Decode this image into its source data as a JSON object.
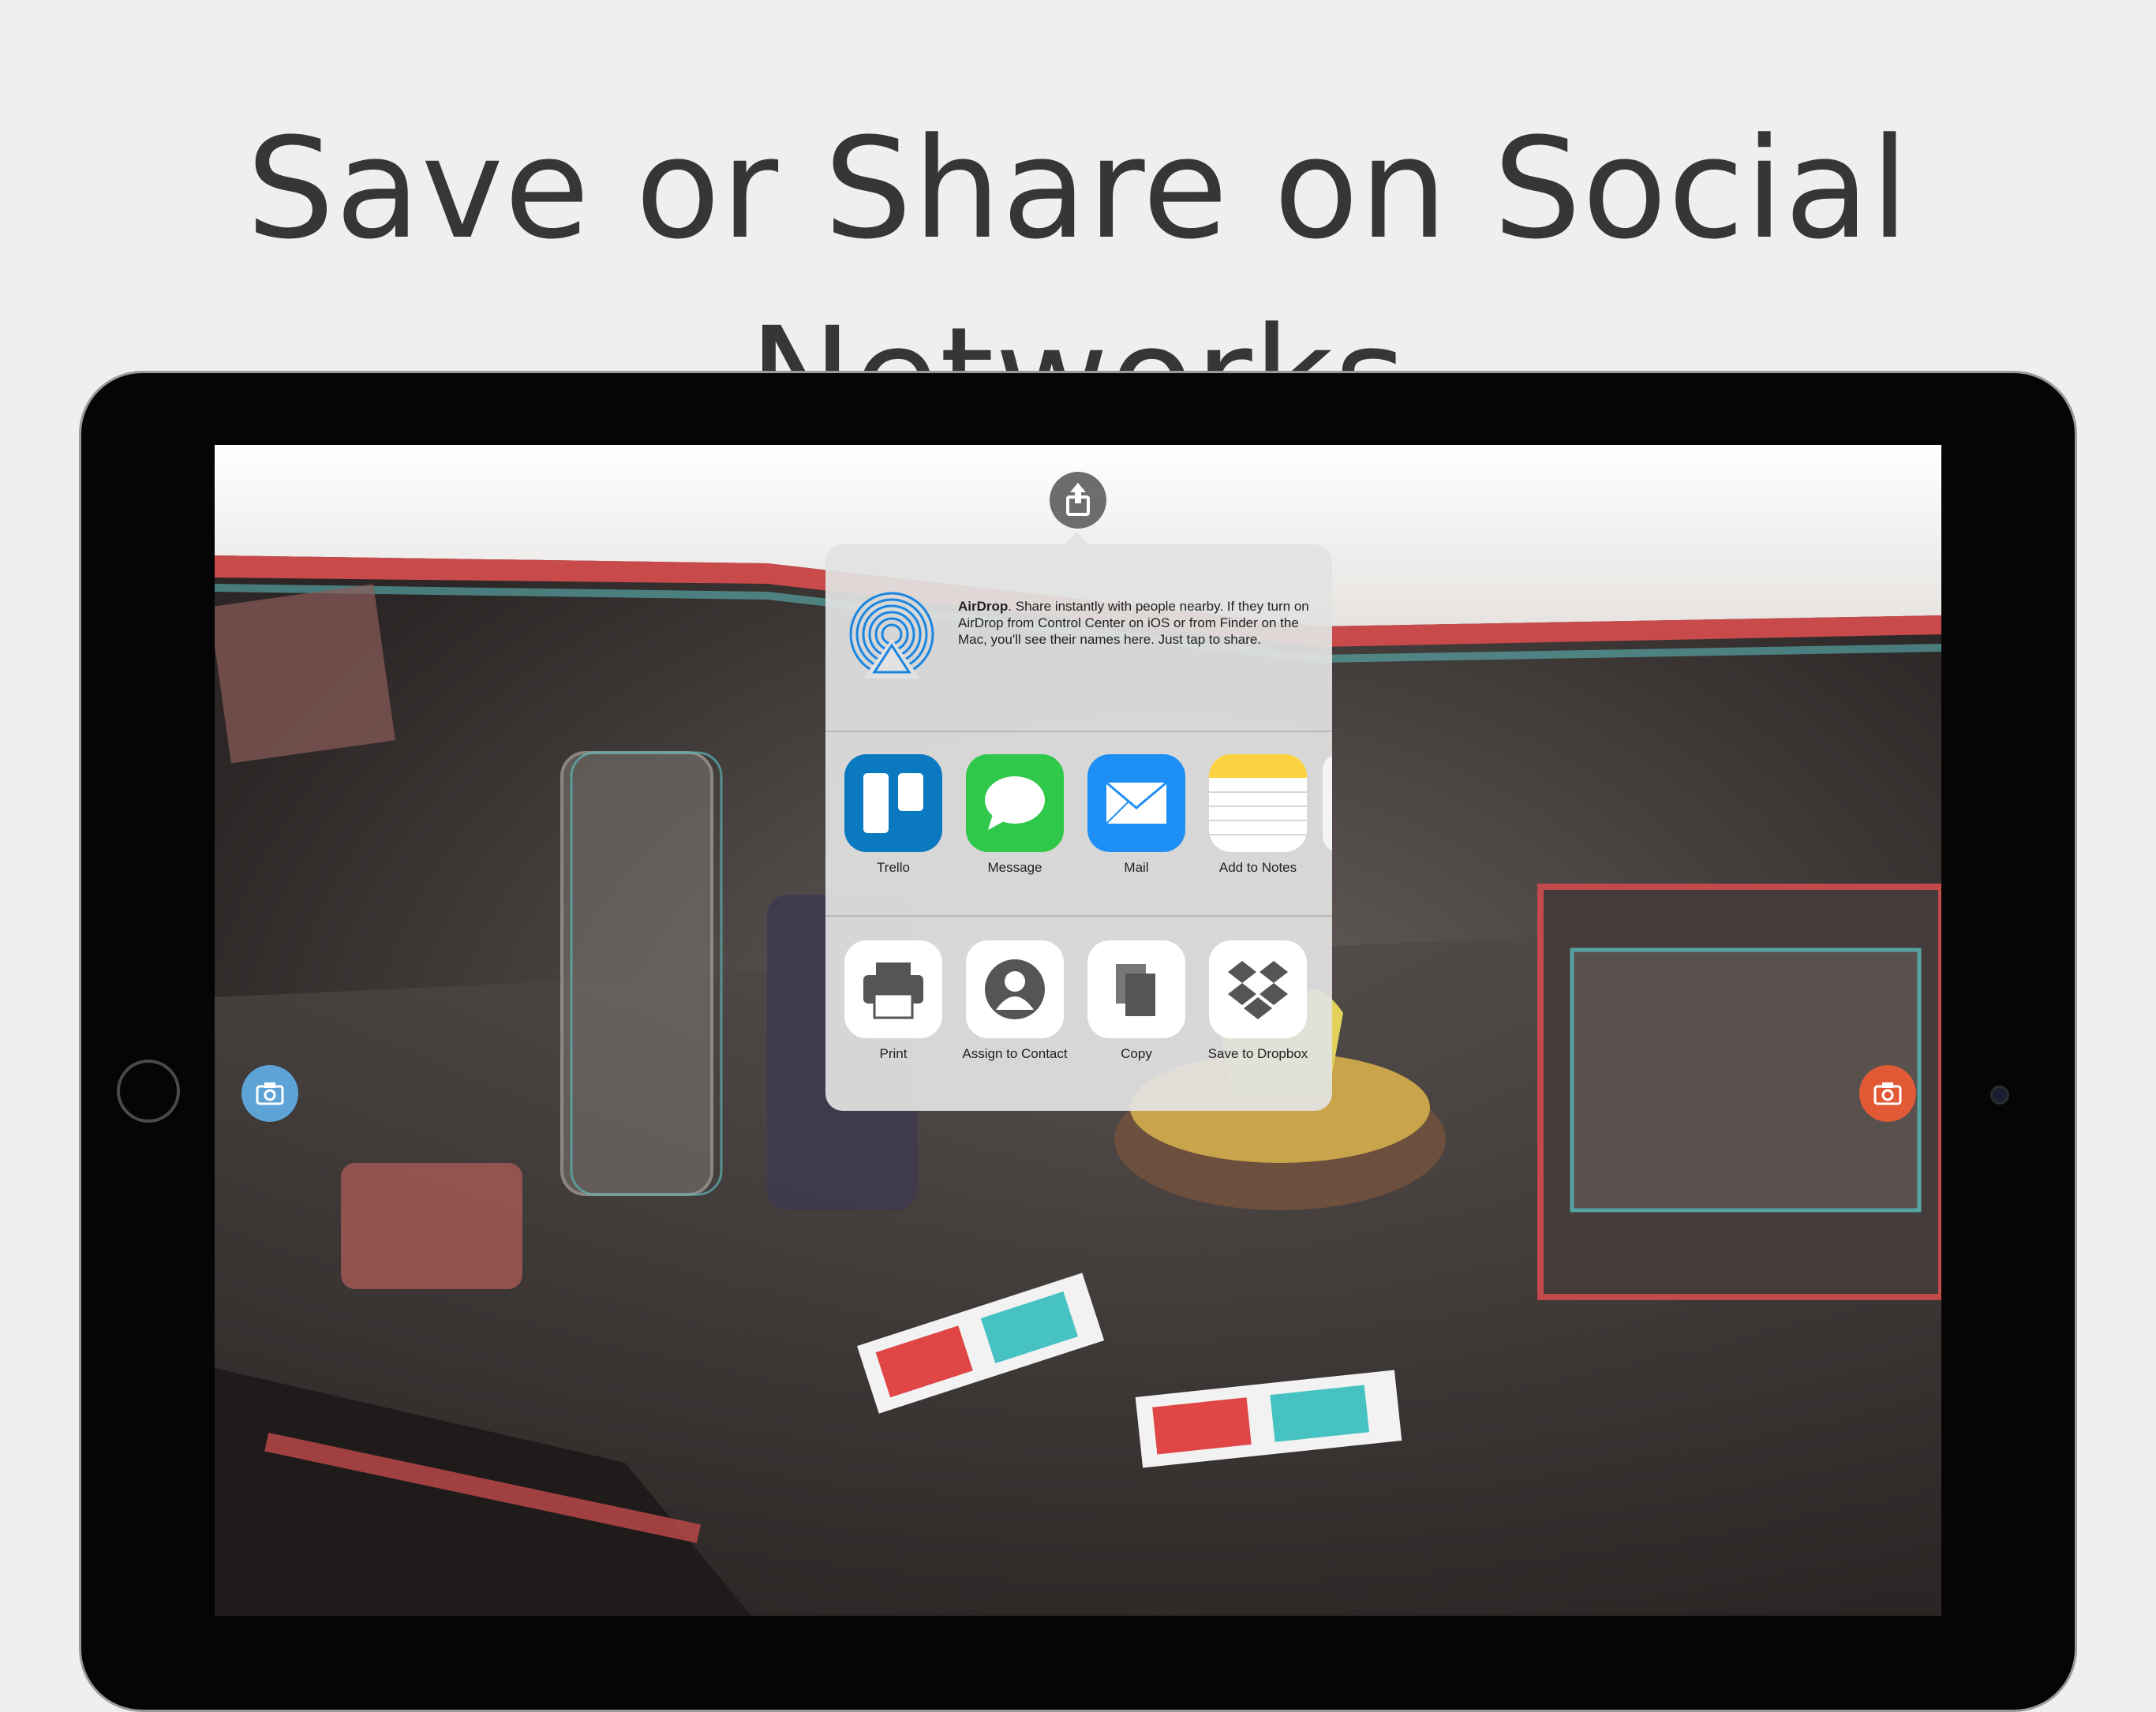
{
  "headline": "Save or Share on Social Networks",
  "share_sheet": {
    "airdrop": {
      "title": "AirDrop",
      "description": ". Share instantly with people nearby. If they turn on AirDrop from Control Center on iOS or from Finder on the Mac, you'll see their names here. Just tap to share."
    },
    "apps": [
      {
        "label": "Trello",
        "icon": "trello-icon",
        "color": "#0a79bf"
      },
      {
        "label": "Message",
        "icon": "messages-icon",
        "color": "#2fc84a"
      },
      {
        "label": "Mail",
        "icon": "mail-icon",
        "color": "#1e8ff5"
      },
      {
        "label": "Add to Notes",
        "icon": "notes-icon",
        "color": "#fbd23f"
      }
    ],
    "actions": [
      {
        "label": "Print",
        "icon": "printer-icon"
      },
      {
        "label": "Assign to Contact",
        "icon": "contact-icon"
      },
      {
        "label": "Copy",
        "icon": "copy-icon"
      },
      {
        "label": "Save to Dropbox",
        "icon": "dropbox-icon"
      }
    ]
  },
  "colors": {
    "left_camera_button": "#5da3d6",
    "right_camera_button": "#e25a35",
    "share_button": "#6d6d6d"
  }
}
